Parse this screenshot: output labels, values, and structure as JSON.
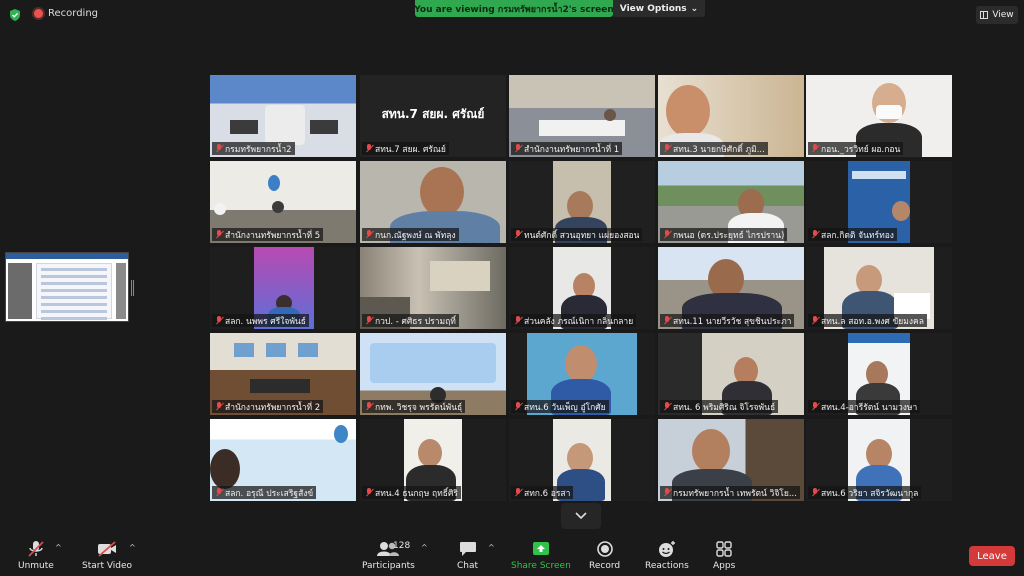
{
  "top": {
    "recording_label": "Recording",
    "viewing_banner": "You are viewing กรมทรัพยากรน้ำ2's screen",
    "view_options_label": "View Options",
    "view_label": "View"
  },
  "tiles": [
    {
      "name": "กรมทรัพยากรน้ำ2",
      "active": true
    },
    {
      "name": "สทน.7 สยผ. ศรัณย์",
      "text_only": "สทน.7 สยผ. ศรัณย์"
    },
    {
      "name": "สำนักงานทรัพยากรน้ำที่ 1"
    },
    {
      "name": "สทน.3 นายกษิศักดิ์ ภูมิ..."
    },
    {
      "name": "กอน._วรวิทย์ ผอ.กอน"
    },
    {
      "name": "สำนักงานทรัพยากรน้ำที่ 5"
    },
    {
      "name": "กนก.ณัฐพงษ์ ณ พัทลุง"
    },
    {
      "name": "ทนต์ศักดิ์ สวนอุทยา แผ่ยองสอน"
    },
    {
      "name": "กพนอ (ดร.ประยุทธ์ ไกรปราน)"
    },
    {
      "name": "สลก.กิตติ จันทร์ทอง"
    },
    {
      "name": "สลก. นพพร ศรีใจพันธ์"
    },
    {
      "name": "กวป. - ศศิธร ปรามฤทิ์"
    },
    {
      "name": "ส่วนคลัง ภรณ์เนิกา กลิ่นกลาย"
    },
    {
      "name": "สทน.11 นายวีรวัช สุขชินประภา"
    },
    {
      "name": "สทน.ล สอท.อ.พงศ ขัยมงคล"
    },
    {
      "name": "สำนักงานทรัพยากรน้ำที่ 2"
    },
    {
      "name": "กทพ. วิชรุจ พรรัตน์พันธุ์"
    },
    {
      "name": "สทน.6 วันเพ็ญ อู๋โกศัย"
    },
    {
      "name": "สทน. 6 พริมศิริณ จิโรจพันธ์"
    },
    {
      "name": "สทน.4-อารีรัตน์ นามวงษา"
    },
    {
      "name": "สลก. อรุณี ประเสริฐสังข์"
    },
    {
      "name": "สทน.4 ธนกฤษ ฤทธิ์ศิริ"
    },
    {
      "name": "สทก.6 อรสา"
    },
    {
      "name": "กรมทรัพยากรน้ำ เทพรัตน์ วิจิโย..."
    },
    {
      "name": "สทน.6 วริยา สจิรวัฒนากุล"
    }
  ],
  "toolbar": {
    "unmute": "Unmute",
    "start_video": "Start Video",
    "participants": "Participants",
    "participants_count": "128",
    "chat": "Chat",
    "share_screen": "Share Screen",
    "record": "Record",
    "reactions": "Reactions",
    "apps": "Apps",
    "leave": "Leave"
  },
  "colors": {
    "accent_green": "#2fa84f",
    "leave_red": "#d43a3a",
    "active_outline": "#cfe04a"
  }
}
